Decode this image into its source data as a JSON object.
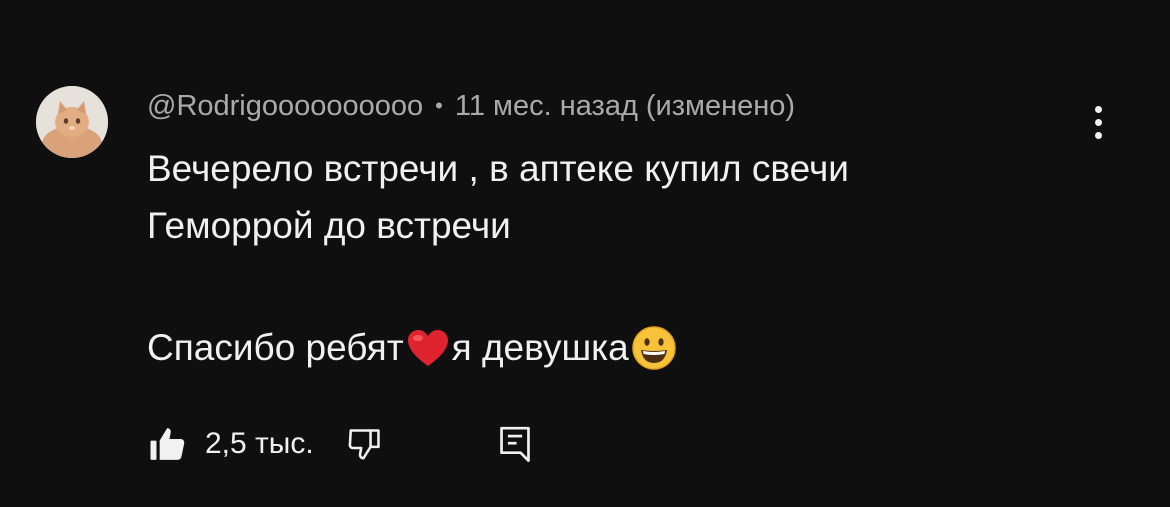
{
  "comment": {
    "author": "@Rodrigoooooooooo",
    "separator": "•",
    "time": "11 мес. назад",
    "edited": "(изменено)",
    "lines": [
      "Вечерело встречи , в аптеке купил свечи",
      "Геморрой до встречи"
    ],
    "last_line_parts": [
      "Спасибо ребят",
      "я девушка"
    ],
    "likes": "2,5 тыс."
  },
  "icons": {
    "avatar": "cat-avatar",
    "heart": "red-heart-emoji",
    "smile": "grinning-face-emoji",
    "more": "more-vertical-icon",
    "like": "thumbs-up-filled-icon",
    "dislike": "thumbs-down-outline-icon",
    "reply": "reply-comment-icon"
  },
  "colors": {
    "background": "#0f0f0f",
    "text_primary": "#f1f1f1",
    "text_secondary": "#aaaaaa",
    "heart": "#e0242f",
    "smile": "#f6c23a"
  }
}
